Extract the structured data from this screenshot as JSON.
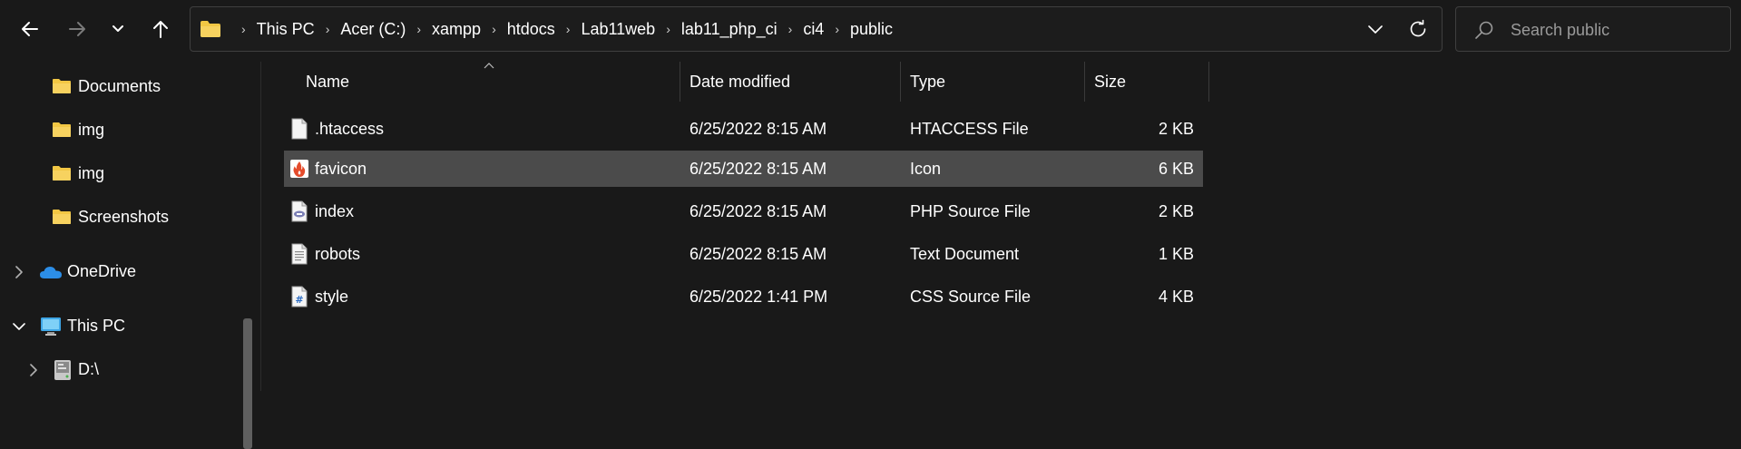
{
  "toolbar": {
    "back_icon": "arrow-left-icon",
    "forward_icon": "arrow-right-icon",
    "recent_icon": "chevron-down-icon",
    "up_icon": "arrow-up-icon"
  },
  "address": {
    "folder_icon": "folder-icon",
    "breadcrumbs": [
      "This PC",
      "Acer (C:)",
      "xampp",
      "htdocs",
      "Lab11web",
      "lab11_php_ci",
      "ci4",
      "public"
    ],
    "separator": "›"
  },
  "search": {
    "placeholder": "Search public",
    "value": ""
  },
  "navpane": {
    "items": [
      {
        "label": "Documents",
        "icon": "folder-icon",
        "expandable": false
      },
      {
        "label": "img",
        "icon": "folder-icon",
        "expandable": false
      },
      {
        "label": "img",
        "icon": "folder-icon",
        "expandable": false
      },
      {
        "label": "Screenshots",
        "icon": "folder-icon",
        "expandable": false
      },
      {
        "label": "OneDrive",
        "icon": "cloud-icon",
        "expandable": true,
        "expanded": false
      },
      {
        "label": "This PC",
        "icon": "monitor-icon",
        "expandable": true,
        "expanded": true
      },
      {
        "label": "D:\\",
        "icon": "drive-icon",
        "expandable": true,
        "expanded": false
      }
    ]
  },
  "columns": {
    "name": "Name",
    "date": "Date modified",
    "type": "Type",
    "size": "Size"
  },
  "files": [
    {
      "name": ".htaccess",
      "date": "6/25/2022 8:15 AM",
      "type": "HTACCESS File",
      "size": "2 KB",
      "icon": "file-icon",
      "selected": false
    },
    {
      "name": "favicon",
      "date": "6/25/2022 8:15 AM",
      "type": "Icon",
      "size": "6 KB",
      "icon": "codeigniter-flame-icon",
      "selected": true
    },
    {
      "name": "index",
      "date": "6/25/2022 8:15 AM",
      "type": "PHP Source File",
      "size": "2 KB",
      "icon": "php-file-icon",
      "selected": false
    },
    {
      "name": "robots",
      "date": "6/25/2022 8:15 AM",
      "type": "Text Document",
      "size": "1 KB",
      "icon": "text-file-icon",
      "selected": false
    },
    {
      "name": "style",
      "date": "6/25/2022 1:41 PM",
      "type": "CSS Source File",
      "size": "4 KB",
      "icon": "css-file-icon",
      "selected": false
    }
  ],
  "colors": {
    "background": "#191919",
    "selected_row": "#4b4b4b",
    "folder": "#f2c744",
    "onedrive": "#2c8ee8"
  }
}
